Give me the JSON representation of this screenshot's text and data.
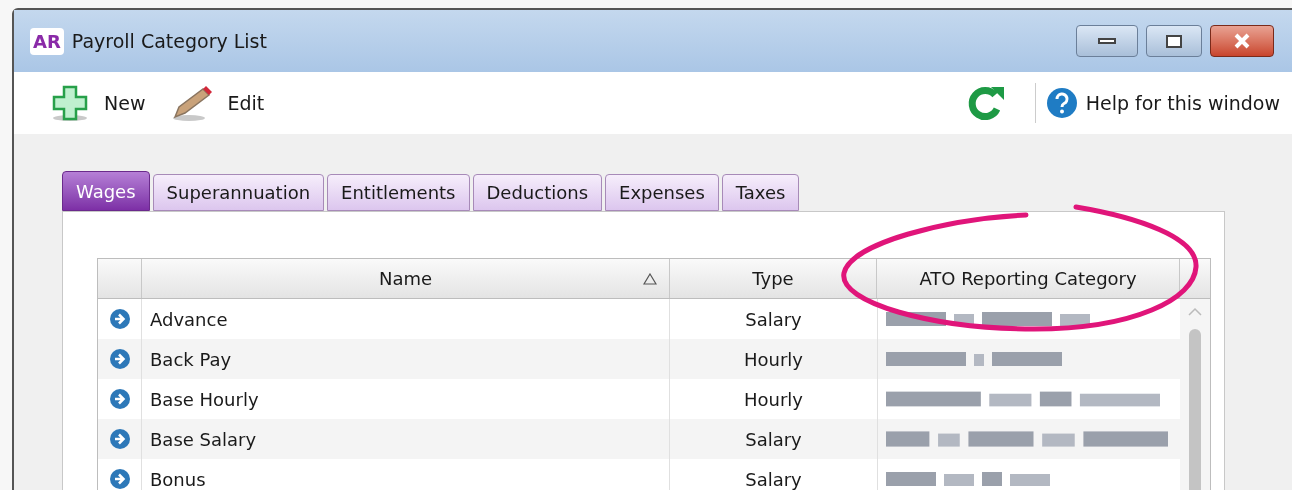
{
  "window": {
    "logo": "AR",
    "title": "Payroll Category List"
  },
  "toolbar": {
    "actions": [
      {
        "label": "New",
        "kind": "new"
      },
      {
        "label": "Edit",
        "kind": "edit"
      }
    ],
    "help": "Help for this window"
  },
  "tabs": [
    {
      "label": "Wages",
      "selected": true
    },
    {
      "label": "Superannuation",
      "selected": false
    },
    {
      "label": "Entitlements",
      "selected": false
    },
    {
      "label": "Deductions",
      "selected": false
    },
    {
      "label": "Expenses",
      "selected": false
    },
    {
      "label": "Taxes",
      "selected": false
    }
  ],
  "table": {
    "columns": [
      {
        "label": "Name",
        "sorted": true
      },
      {
        "label": "Type",
        "sorted": false
      },
      {
        "label": "ATO Reporting Category",
        "sorted": false
      }
    ],
    "rows": [
      {
        "name": "Advance",
        "type": "Salary"
      },
      {
        "name": "Back Pay",
        "type": "Hourly"
      },
      {
        "name": "Base Hourly",
        "type": "Hourly"
      },
      {
        "name": "Base Salary",
        "type": "Salary"
      },
      {
        "name": "Bonus",
        "type": "Salary"
      }
    ]
  }
}
